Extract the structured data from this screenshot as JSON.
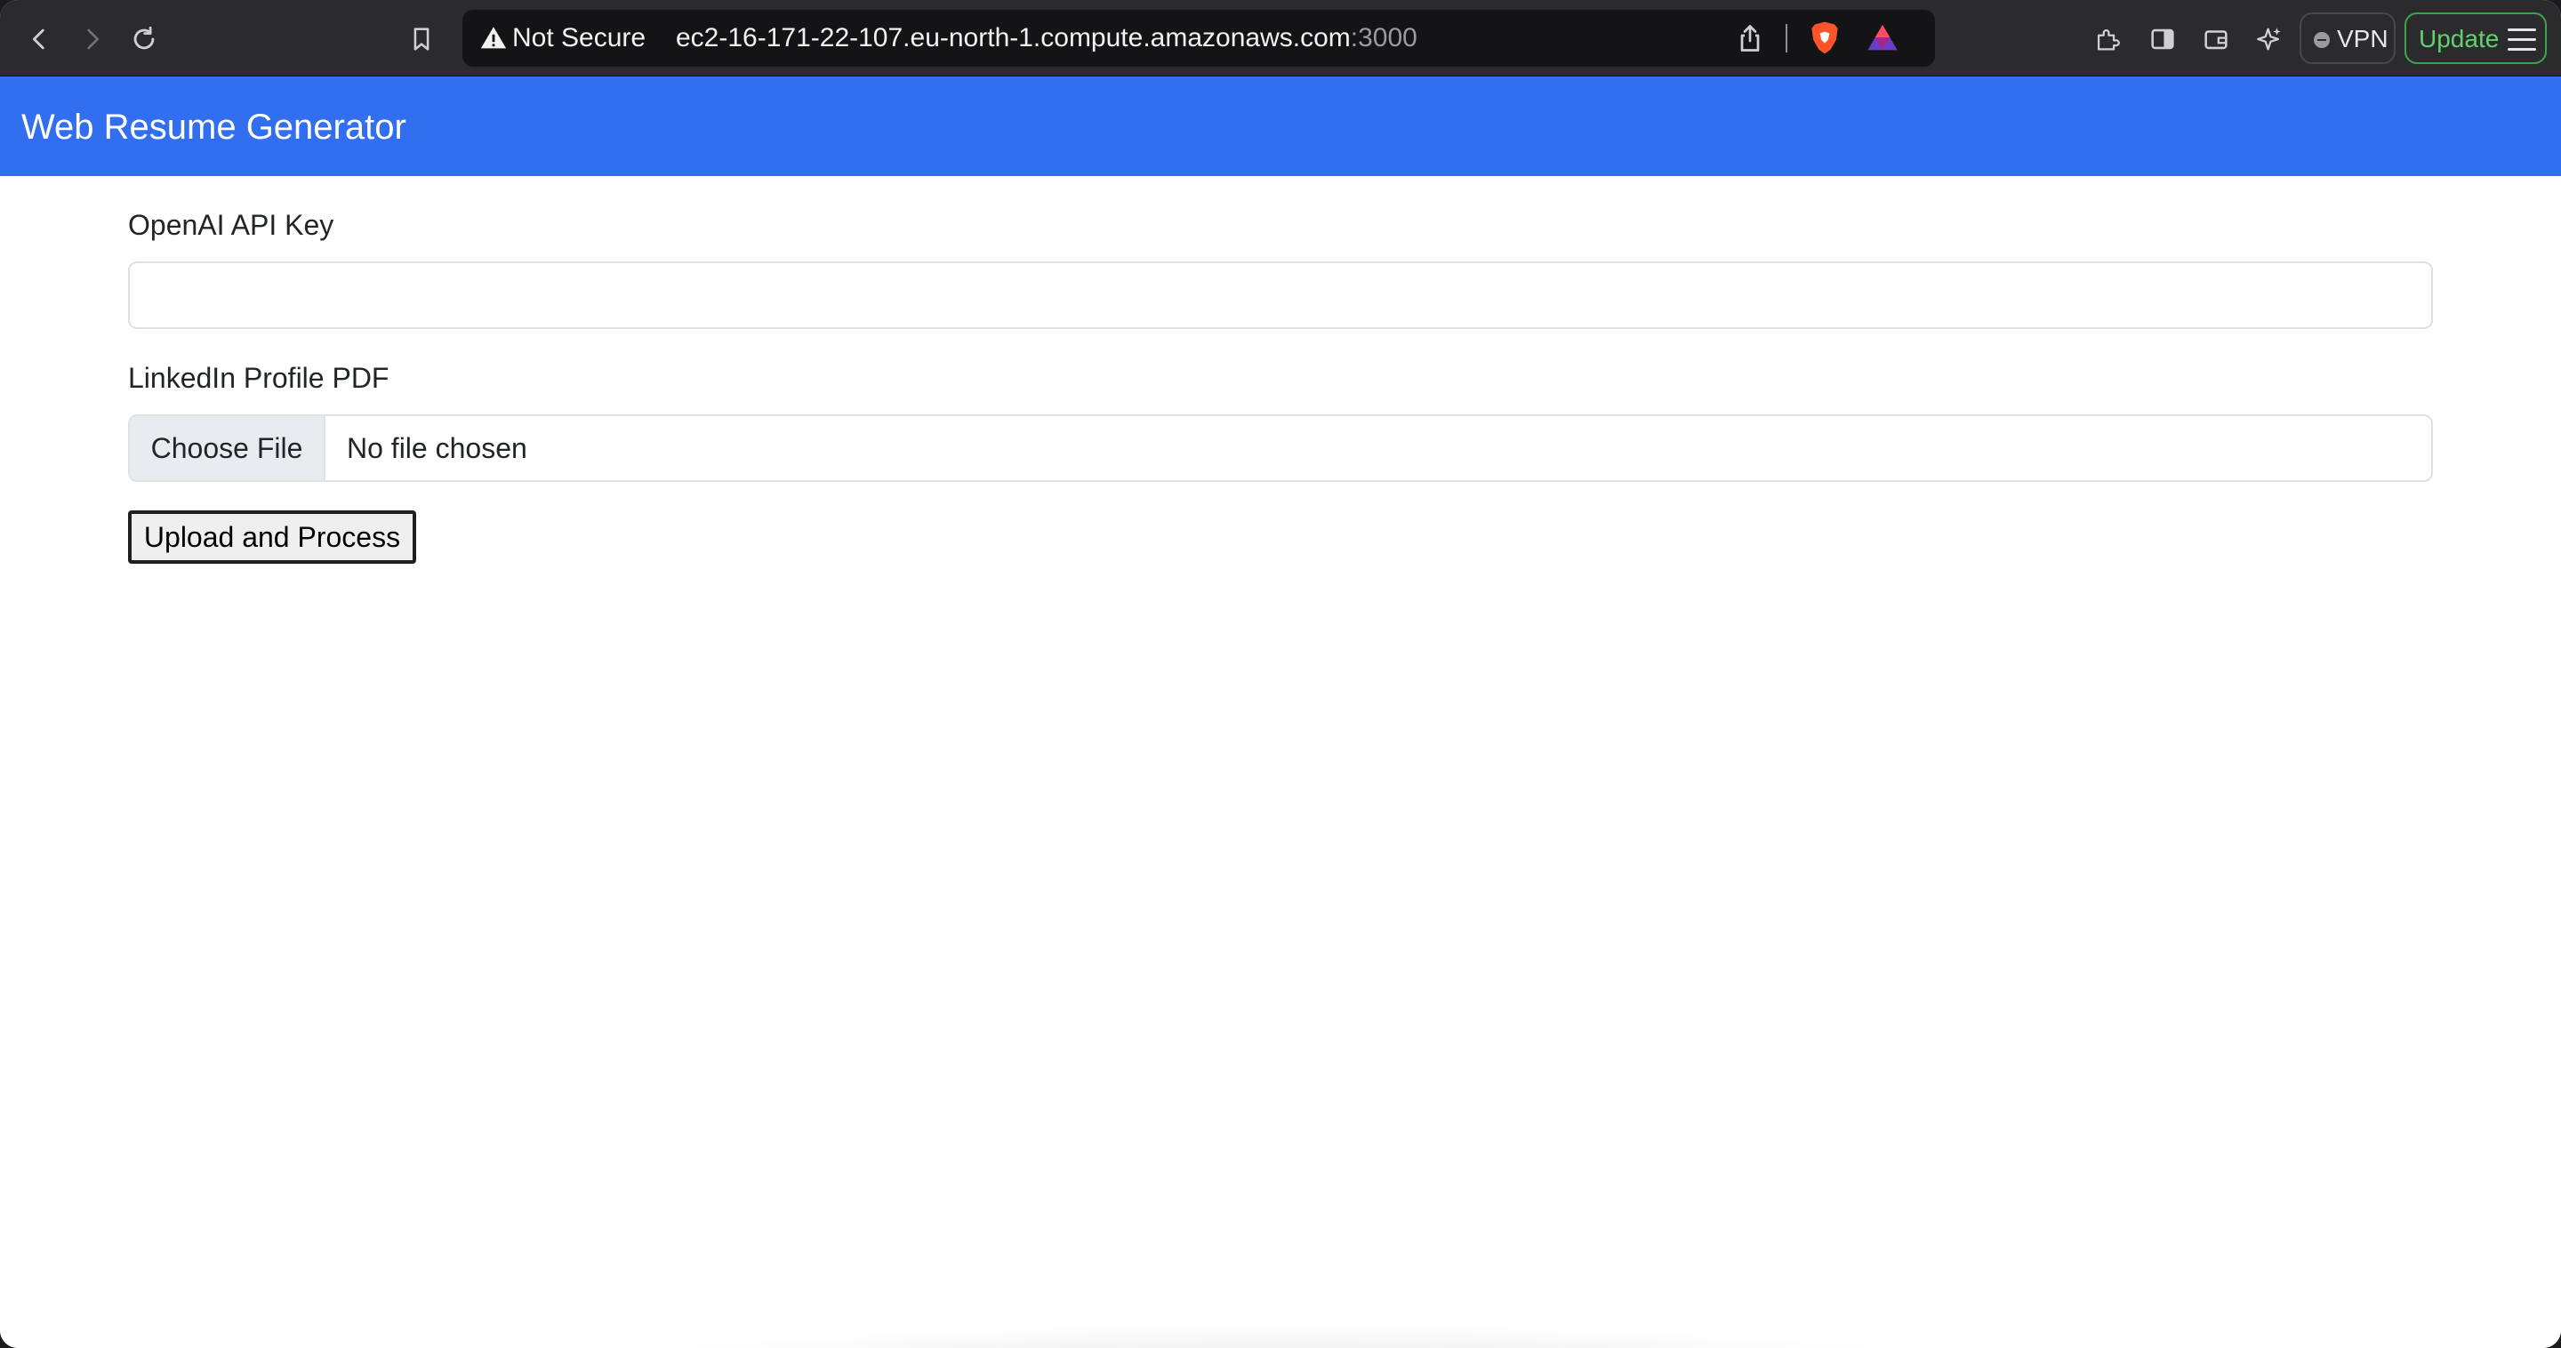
{
  "browser": {
    "security_label": "Not Secure",
    "url_host": "ec2-16-171-22-107.eu-north-1.compute.amazonaws.com",
    "url_port": ":3000",
    "vpn_label": "VPN",
    "update_label": "Update"
  },
  "app": {
    "title": "Web Resume Generator"
  },
  "form": {
    "api_key_label": "OpenAI API Key",
    "api_key_value": "",
    "pdf_label": "LinkedIn Profile PDF",
    "choose_file_label": "Choose File",
    "file_status": "No file chosen",
    "submit_label": "Upload and Process"
  }
}
